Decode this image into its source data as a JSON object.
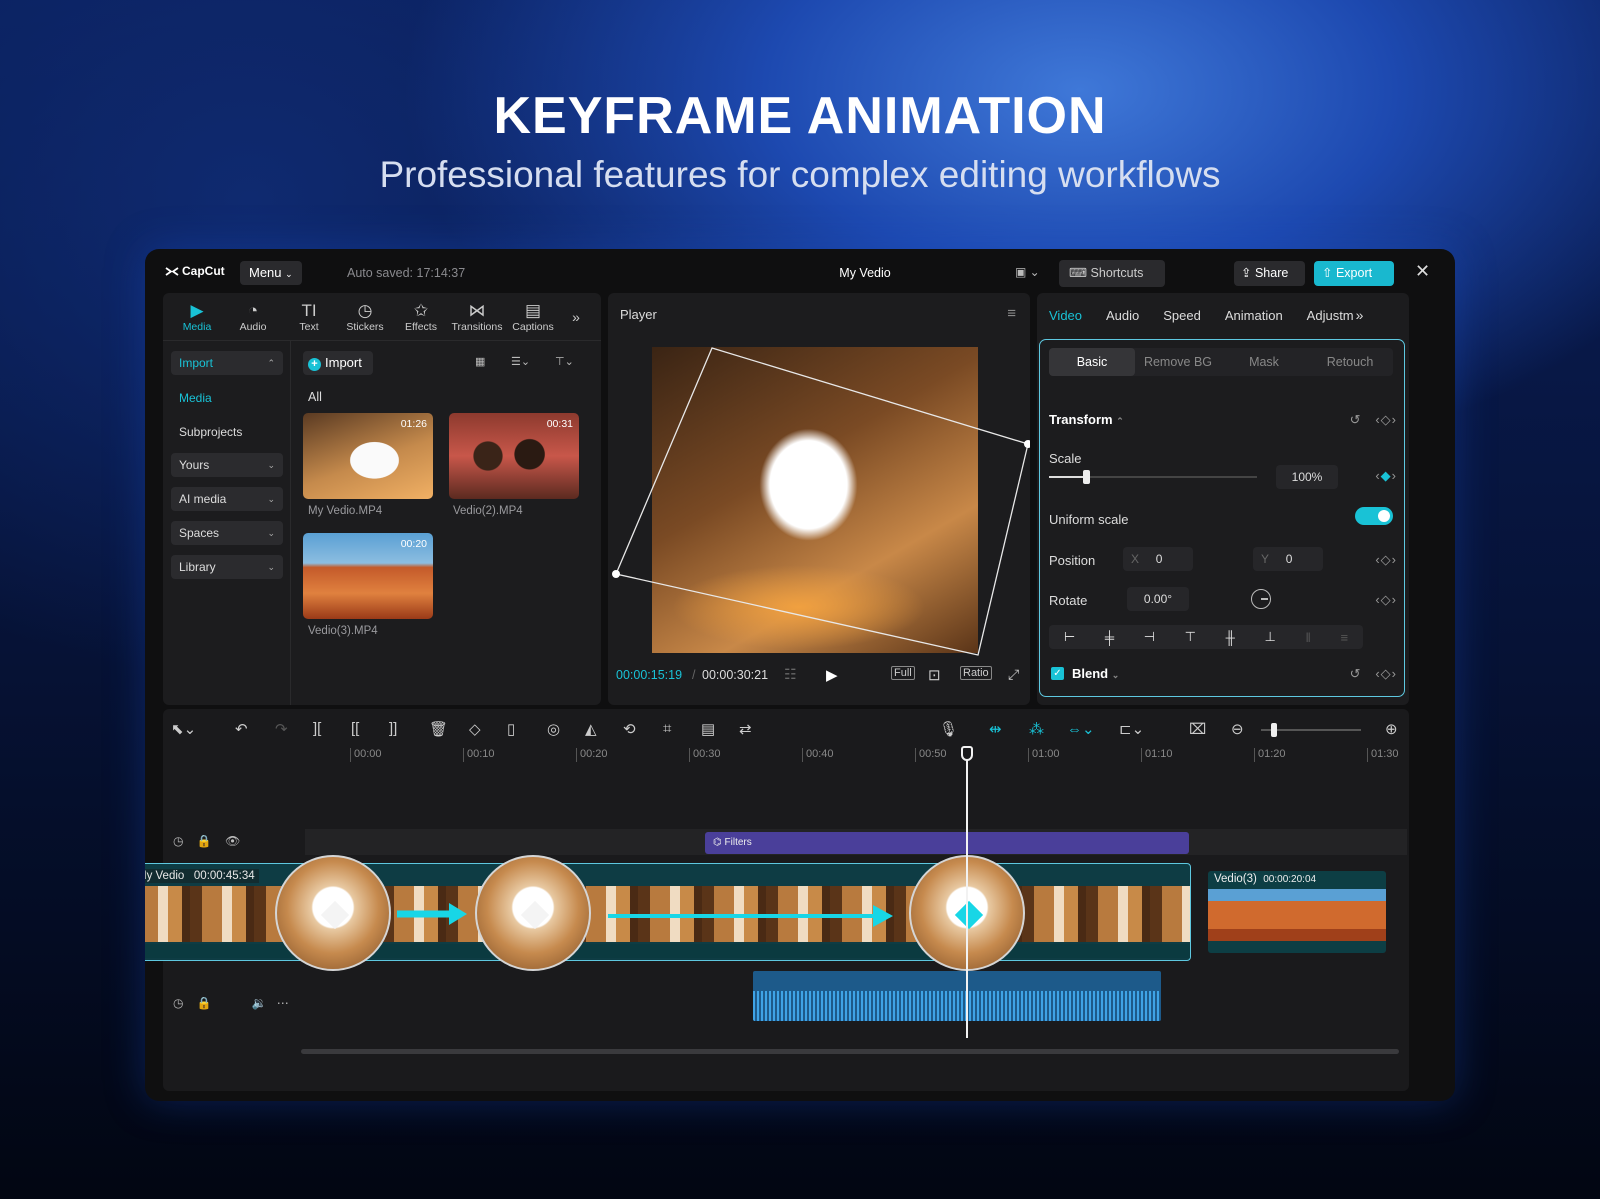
{
  "hero": {
    "title": "KEYFRAME ANIMATION",
    "subtitle": "Professional features for complex editing workflows"
  },
  "app": {
    "logo": "CapCut",
    "menu": "Menu",
    "autosave": "Auto saved: 17:14:37",
    "project": "My Vedio",
    "shortcuts": "Shortcuts",
    "share": "Share",
    "export": "Export"
  },
  "tools": [
    {
      "label": "Media",
      "icon": "media-icon"
    },
    {
      "label": "Audio",
      "icon": "audio-icon"
    },
    {
      "label": "Text",
      "icon": "text-icon"
    },
    {
      "label": "Stickers",
      "icon": "stickers-icon"
    },
    {
      "label": "Effects",
      "icon": "effects-icon"
    },
    {
      "label": "Transitions",
      "icon": "transitions-icon"
    },
    {
      "label": "Captions",
      "icon": "captions-icon"
    }
  ],
  "nav": {
    "import": "Import",
    "media": "Media",
    "subprojects": "Subprojects",
    "yours": "Yours",
    "ai_media": "AI media",
    "spaces": "Spaces",
    "library": "Library"
  },
  "media": {
    "import_btn": "Import",
    "all": "All",
    "items": [
      {
        "name": "My Vedio.MP4",
        "duration": "01:26"
      },
      {
        "name": "Vedio(2).MP4",
        "duration": "00:31"
      },
      {
        "name": "Vedio(3).MP4",
        "duration": "00:20"
      }
    ]
  },
  "player": {
    "title": "Player",
    "current": "00:00:15:19",
    "total": "00:00:30:21",
    "full": "Full",
    "ratio": "Ratio"
  },
  "props": {
    "tabs": [
      "Video",
      "Audio",
      "Speed",
      "Animation",
      "Adjustm"
    ],
    "subtabs": [
      "Basic",
      "Remove BG",
      "Mask",
      "Retouch"
    ],
    "transform": "Transform",
    "scale_label": "Scale",
    "scale_value": "100%",
    "scale_fraction": 0.18,
    "uniform_scale": "Uniform scale",
    "position": "Position",
    "pos_x_label": "X",
    "pos_x": "0",
    "pos_y_label": "Y",
    "pos_y": "0",
    "rotate": "Rotate",
    "rotate_value": "0.00°",
    "blend": "Blend"
  },
  "timeline": {
    "ticks": [
      "00:00",
      "00:10",
      "00:20",
      "00:30",
      "00:40",
      "00:50",
      "01:00",
      "01:10",
      "01:20",
      "01:30"
    ],
    "filters": "Filters",
    "main_clip": "My Vedio",
    "main_clip_time": "00:00:45:34",
    "clip3": "Vedio(3)",
    "clip3_time": "00:00:20:04"
  },
  "colors": {
    "accent": "#19c2d6",
    "filters": "#4a3f9a",
    "audio": "#2b86c8"
  }
}
